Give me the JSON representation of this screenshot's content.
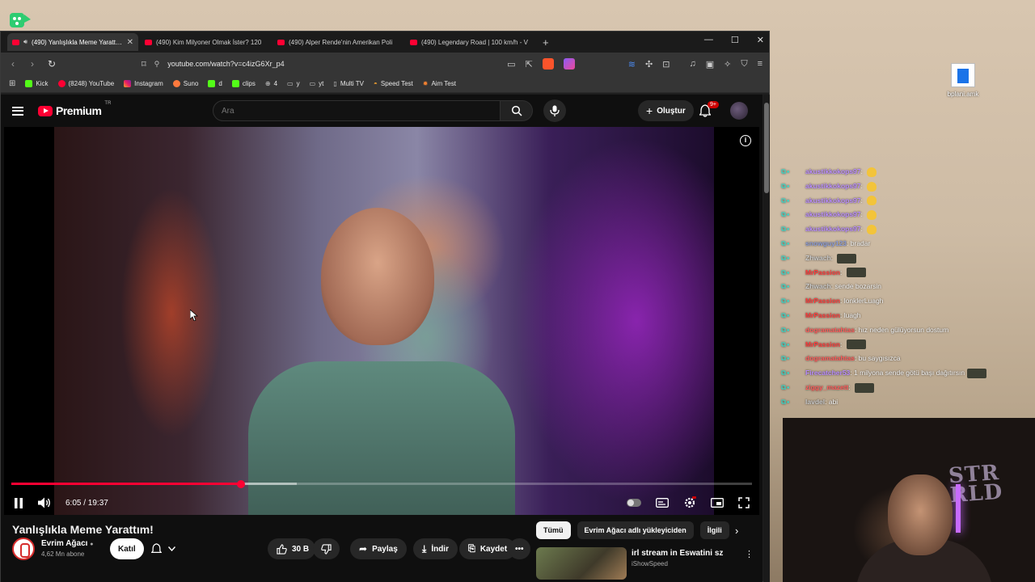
{
  "browser": {
    "tabs": [
      {
        "title": "(490) Yanlışlıkla Meme Yarattım",
        "active": true
      },
      {
        "title": "(490) Kim Milyoner Olmak İster? 120",
        "active": false
      },
      {
        "title": "(490) Alper Rende'nin Amerikan Poli",
        "active": false
      },
      {
        "title": "(490) Legendary Road | 100 km/h - V",
        "active": false
      }
    ],
    "url": "youtube.com/watch?v=c4izG6Xr_p4",
    "bookmarks": [
      "Kick",
      "(8248) YouTube",
      "Instagram",
      "Suno",
      "d",
      "clips",
      "4",
      "y",
      "yt",
      "Multi TV",
      "Speed Test",
      "Aim Test"
    ],
    "accent": "#ff0033"
  },
  "youtube": {
    "logo_text": "Premium",
    "logo_region": "TR",
    "search_placeholder": "Ara",
    "create_label": "Oluştur",
    "notifications_badge": "9+",
    "player": {
      "time": "6:05 / 19:37",
      "progress_percent": 31
    },
    "video": {
      "title": "Yanlışlıkla Meme Yarattım!",
      "channel": "Evrim Ağacı",
      "subscribers": "4,62 Mn abone",
      "join_label": "Katıl",
      "likes": "30 B",
      "share_label": "Paylaş",
      "download_label": "İndir",
      "save_label": "Kaydet"
    },
    "chips": [
      "Tümü",
      "Evrim Ağacı adlı yükleyiciden",
      "İlgili"
    ],
    "recommended": {
      "title": "irl stream in  Eswatini sz",
      "channel": "iShowSpeed"
    }
  },
  "desktop": {
    "file_label": "bplani.amk"
  },
  "chat": [
    {
      "user": "akustikkokops97",
      "color": "#b98cff",
      "message": "",
      "emote": "hand"
    },
    {
      "user": "akustikkokops97",
      "color": "#b98cff",
      "message": "",
      "emote": "hand"
    },
    {
      "user": "akustikkokops97",
      "color": "#b98cff",
      "message": "",
      "emote": "hand"
    },
    {
      "user": "akustikkokops97",
      "color": "#b98cff",
      "message": "",
      "emote": "hand"
    },
    {
      "user": "akustikkokops97",
      "color": "#b98cff",
      "message": "",
      "emote": "hand"
    },
    {
      "user": "snowguy123",
      "color": "#8a9bd6",
      "message": "bradar",
      "emote": ""
    },
    {
      "user": "Zhwach",
      "color": "#c9c9c9",
      "message": "",
      "emote": "img"
    },
    {
      "user": "MrPassion",
      "color": "#ff3b3b",
      "message": "",
      "emote": "img"
    },
    {
      "user": "Zhwach",
      "color": "#c9c9c9",
      "message": "sende bozarsin",
      "emote": ""
    },
    {
      "user": "MrPassion",
      "color": "#ff3b3b",
      "message": "lonklerLuagh",
      "emote": ""
    },
    {
      "user": "MrPassion",
      "color": "#ff3b3b",
      "message": "luagh",
      "emote": ""
    },
    {
      "user": "dogramatahtas",
      "color": "#ff5a5a",
      "message": "hız neden gülüyorsun dostum",
      "emote": ""
    },
    {
      "user": "MrPassion",
      "color": "#ff3b3b",
      "message": "",
      "emote": "img"
    },
    {
      "user": "dogramatahtas",
      "color": "#ff5a5a",
      "message": "bu saygısızca",
      "emote": ""
    },
    {
      "user": "Firecatcher53",
      "color": "#b98cff",
      "message": "1 milyona sende götü başı dağıtırsın",
      "emote": "img"
    },
    {
      "user": "ziggy_mazett",
      "color": "#ff5a5a",
      "message": "",
      "emote": "img"
    },
    {
      "user": "lavdel",
      "color": "#c9c9c9",
      "message": "abi",
      "emote": ""
    }
  ]
}
